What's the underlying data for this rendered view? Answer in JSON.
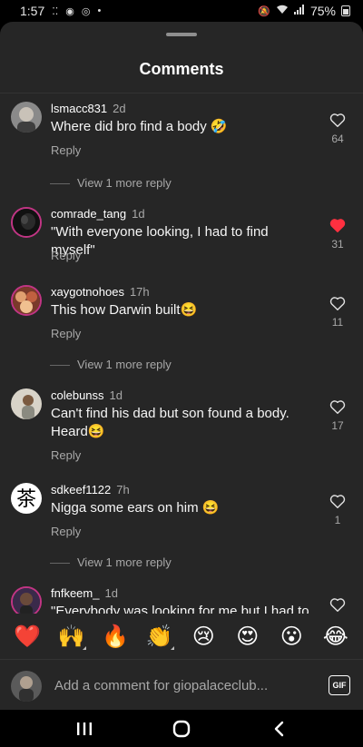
{
  "status_bar": {
    "time": "1:57",
    "battery": "75%"
  },
  "sheet": {
    "title": "Comments"
  },
  "comments": [
    {
      "username": "lsmacc831",
      "time": "2d",
      "text": "Where did bro find a body 🤣",
      "reply_label": "Reply",
      "likes": "64",
      "liked": false,
      "view_replies": "View 1 more reply"
    },
    {
      "username": "comrade_tang",
      "time": "1d",
      "text": "\"With everyone looking, I had to find myself\"",
      "reply_label": "Reply",
      "likes": "31",
      "liked": true
    },
    {
      "username": "xaygotnohoes",
      "time": "17h",
      "text": "This how Darwin built😆",
      "reply_label": "Reply",
      "likes": "11",
      "liked": false,
      "view_replies": "View 1 more reply"
    },
    {
      "username": "colebunss",
      "time": "1d",
      "text": "Can't find his dad but son found a body. Heard😆",
      "reply_label": "Reply",
      "likes": "17",
      "liked": false
    },
    {
      "username": "sdkeef1122",
      "time": "7h",
      "text": "Nigga some ears on him 😆",
      "reply_label": "Reply",
      "likes": "1",
      "liked": false,
      "view_replies": "View 1 more reply"
    },
    {
      "username": "fnfkeem_",
      "time": "1d",
      "text": "\"Everybody was looking for me but I had to",
      "liked": false
    }
  ],
  "emoji_bar": [
    "❤️",
    "🙌",
    "🔥",
    "👏",
    "😢",
    "😍",
    "😮",
    "😂"
  ],
  "input": {
    "placeholder": "Add a comment for giopalaceclub..."
  },
  "gif_label": "GIF",
  "icons": {
    "like": "heart-outline-icon",
    "liked": "heart-filled-icon",
    "nav": [
      "recents-icon",
      "home-icon",
      "back-icon"
    ]
  },
  "colors": {
    "sheet_bg": "#262626",
    "liked_red": "#ff3040",
    "secondary_text": "#a8a8a8"
  }
}
